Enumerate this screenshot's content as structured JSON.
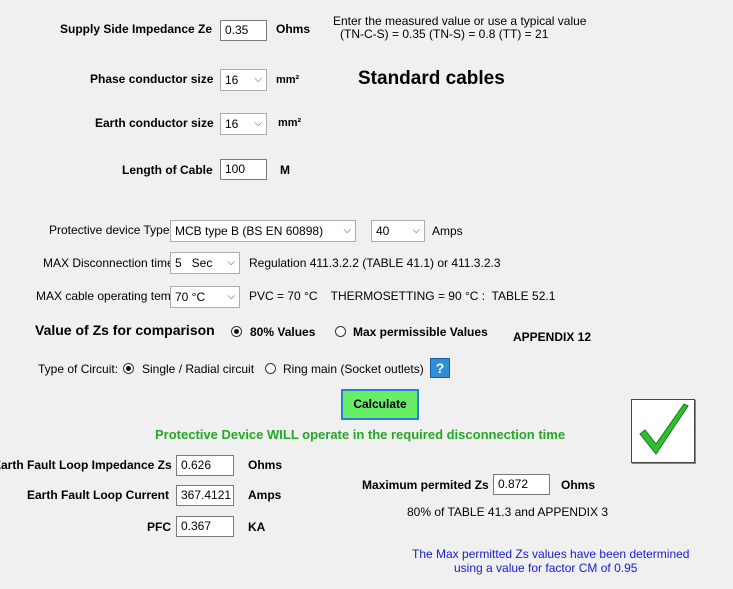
{
  "supply": {
    "label": "Supply Side Impedance Ze",
    "value": "0.35",
    "unit": "Ohms",
    "hint_line1": "Enter the measured value or use a typical value",
    "hint_line2": "(TN-C-S) = 0.35    (TN-S) = 0.8    (TT) = 21"
  },
  "phase": {
    "label": "Phase conductor size",
    "value": "16",
    "unit": "mm²"
  },
  "standard_title": "Standard cables",
  "earth": {
    "label": "Earth conductor size",
    "value": "16",
    "unit": "mm²"
  },
  "length": {
    "label": "Length of Cable",
    "value": "100",
    "unit": "M"
  },
  "device": {
    "label": "Protective device Type",
    "type_value": "MCB type B (BS EN 60898)",
    "rating_value": "40",
    "rating_unit": "Amps"
  },
  "disconnect": {
    "label": "MAX Disconnection time",
    "value": "5   Sec",
    "regulation": "Regulation 411.3.2.2  (TABLE 41.1) or 411.3.2.3"
  },
  "temp": {
    "label": "MAX cable operating temp",
    "value": "70 °C",
    "note": "PVC = 70 °C    THERMOSETTING = 90 °C :  TABLE 52.1"
  },
  "zs_compare": {
    "label": "Value of Zs for comparison",
    "opt1": "80% Values",
    "opt2": "Max permissible Values",
    "selected": "80% Values",
    "appendix": "APPENDIX 12"
  },
  "circuit": {
    "label": "Type of Circuit:",
    "opt1": "Single / Radial circuit",
    "opt2": "Ring main (Socket outlets)",
    "selected": "Single / Radial circuit",
    "help_label": "?"
  },
  "calculate_label": "Calculate",
  "result_message": "Protective Device WILL operate in the required disconnection time",
  "result_color": "#22aa22",
  "result_icon": "green-checkmark-icon",
  "efli": {
    "label": "Earth Fault Loop Impedance Zs",
    "value": "0.626",
    "unit": "Ohms"
  },
  "eflc": {
    "label": "Earth Fault Loop Current",
    "value": "367.4121",
    "unit": "Amps"
  },
  "pfc": {
    "label": "PFC",
    "value": "0.367",
    "unit": "KA"
  },
  "maxzs": {
    "label": "Maximum permited Zs",
    "value": "0.872",
    "unit": "Ohms",
    "note": "80% of TABLE 41.3 and APPENDIX 3"
  },
  "footnote": {
    "line1": "The Max permitted Zs values have been determined",
    "line2": "using a value for factor CM of 0.95",
    "color": "#1a1ad0"
  }
}
